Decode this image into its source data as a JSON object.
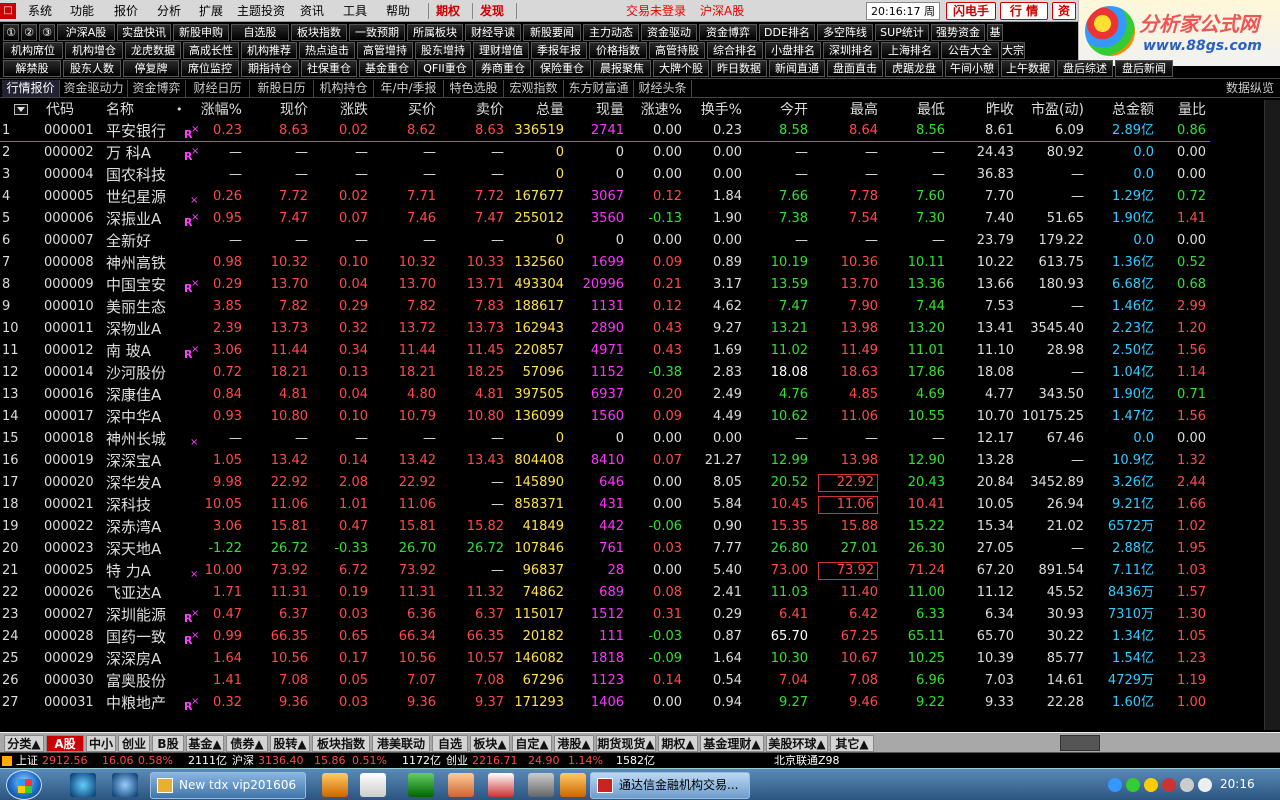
{
  "menubar": {
    "items": [
      "系统",
      "功能",
      "报价",
      "分析",
      "扩展",
      "主题投资",
      "资讯",
      "工具",
      "帮助"
    ],
    "quanquan": "期权",
    "faxian": "发现",
    "status": "交易未登录",
    "market": "沪深A股",
    "clock": "20:16:17 周二",
    "flash": "闪电手",
    "hangqing": "行 情",
    "zi": "资"
  },
  "brand": {
    "title": "分析家公式网",
    "url": "www.88gs.com"
  },
  "quick": {
    "row1": [
      {
        "t": "①",
        "c": ""
      },
      {
        "t": "②",
        "c": ""
      },
      {
        "t": "③",
        "c": ""
      },
      {
        "t": "沪深A股",
        "c": ""
      },
      {
        "t": "实盘快讯",
        "c": ""
      },
      {
        "t": "新股申购",
        "c": ""
      },
      {
        "t": "自选股",
        "c": ""
      },
      {
        "t": "板块指数",
        "c": ""
      },
      {
        "t": "一致预期",
        "c": ""
      },
      {
        "t": "所属板块",
        "c": ""
      },
      {
        "t": "财经导读",
        "c": ""
      },
      {
        "t": "新股要闻",
        "c": ""
      },
      {
        "t": "主力动态",
        "c": ""
      },
      {
        "t": "资金驱动",
        "c": ""
      },
      {
        "t": "资金博弈",
        "c": ""
      },
      {
        "t": "DDE排名",
        "c": ""
      },
      {
        "t": "多空阵线",
        "c": ""
      },
      {
        "t": "SUP统计",
        "c": ""
      },
      {
        "t": "强势资金",
        "c": ""
      },
      {
        "t": "基",
        "c": ""
      }
    ],
    "row2": [
      {
        "t": "机构席位",
        "c": ""
      },
      {
        "t": "机构增仓",
        "c": ""
      },
      {
        "t": "龙虎数据",
        "c": ""
      },
      {
        "t": "高成长性",
        "c": ""
      },
      {
        "t": "机构推荐",
        "c": ""
      },
      {
        "t": "热点追击",
        "c": ""
      },
      {
        "t": "高管增持",
        "c": ""
      },
      {
        "t": "股东增持",
        "c": ""
      },
      {
        "t": "理财增值",
        "c": ""
      },
      {
        "t": "季报年报",
        "c": ""
      },
      {
        "t": "价格指数",
        "c": ""
      },
      {
        "t": "高管持股",
        "c": ""
      },
      {
        "t": "综合排名",
        "c": ""
      },
      {
        "t": "小盘排名",
        "c": ""
      },
      {
        "t": "深圳排名",
        "c": ""
      },
      {
        "t": "上海排名",
        "c": ""
      },
      {
        "t": "公告大全",
        "c": ""
      },
      {
        "t": "大宗",
        "c": ""
      }
    ],
    "row3": [
      {
        "t": "解禁股",
        "c": ""
      },
      {
        "t": "股东人数",
        "c": ""
      },
      {
        "t": "停复牌",
        "c": ""
      },
      {
        "t": "席位监控",
        "c": ""
      },
      {
        "t": "期指持仓",
        "c": ""
      },
      {
        "t": "社保重仓",
        "c": ""
      },
      {
        "t": "基金重仓",
        "c": ""
      },
      {
        "t": "QFII重仓",
        "c": ""
      },
      {
        "t": "券商重仓",
        "c": ""
      },
      {
        "t": "保险重仓",
        "c": ""
      },
      {
        "t": "晨报聚焦",
        "c": ""
      },
      {
        "t": "大牌个股",
        "c": ""
      },
      {
        "t": "昨日数据",
        "c": ""
      },
      {
        "t": "新闻直通",
        "c": ""
      },
      {
        "t": "盘面直击",
        "c": ""
      },
      {
        "t": "虎踞龙盘",
        "c": ""
      },
      {
        "t": "午间小憩",
        "c": ""
      },
      {
        "t": "上午数据",
        "c": ""
      },
      {
        "t": "盘后综述",
        "c": ""
      },
      {
        "t": "盘后新闻",
        "c": ""
      }
    ]
  },
  "tabs": [
    "行情报价",
    "资金驱动力",
    "资金博弈",
    "财经日历",
    "新股日历",
    "机构持仓",
    "年/中/季报",
    "特色选股",
    "宏观指数",
    "东方财富通",
    "财经头条"
  ],
  "tabs_right": "数据纵览",
  "headers": [
    "代码",
    "名称",
    "•",
    "涨幅%",
    "现价",
    "涨跌",
    "买价",
    "卖价",
    "总量",
    "现量",
    "涨速%",
    "换手%",
    "今开",
    "最高",
    "最低",
    "昨收",
    "市盈(动)",
    "总金额",
    "量比"
  ],
  "rows": [
    [
      "1",
      "000001",
      "平安银行",
      "R",
      "0.23",
      "8.63",
      "0.02",
      "8.62",
      "8.63",
      "336519",
      "2741",
      "0.00",
      "0.23",
      "8.58",
      "8.64",
      "8.56",
      "8.61",
      "6.09",
      "2.89亿",
      "0.86"
    ],
    [
      "2",
      "000002",
      "万 科A",
      "R",
      "—",
      "—",
      "—",
      "—",
      "—",
      "0",
      "0",
      "0.00",
      "0.00",
      "—",
      "—",
      "—",
      "24.43",
      "80.92",
      "0.0",
      "0.00"
    ],
    [
      "3",
      "000004",
      "国农科技",
      "",
      "—",
      "—",
      "—",
      "—",
      "—",
      "0",
      "0",
      "0.00",
      "0.00",
      "—",
      "—",
      "—",
      "36.83",
      "—",
      "0.0",
      "0.00"
    ],
    [
      "4",
      "000005",
      "世纪星源",
      "x",
      "0.26",
      "7.72",
      "0.02",
      "7.71",
      "7.72",
      "167677",
      "3067",
      "0.12",
      "1.84",
      "7.66",
      "7.78",
      "7.60",
      "7.70",
      "—",
      "1.29亿",
      "0.72"
    ],
    [
      "5",
      "000006",
      "深振业A",
      "R",
      "0.95",
      "7.47",
      "0.07",
      "7.46",
      "7.47",
      "255012",
      "3560",
      "-0.13",
      "1.90",
      "7.38",
      "7.54",
      "7.30",
      "7.40",
      "51.65",
      "1.90亿",
      "1.41"
    ],
    [
      "6",
      "000007",
      "全新好",
      "",
      "—",
      "—",
      "—",
      "—",
      "—",
      "0",
      "0",
      "0.00",
      "0.00",
      "—",
      "—",
      "—",
      "23.79",
      "179.22",
      "0.0",
      "0.00"
    ],
    [
      "7",
      "000008",
      "神州高铁",
      "",
      "0.98",
      "10.32",
      "0.10",
      "10.32",
      "10.33",
      "132560",
      "1699",
      "0.09",
      "0.89",
      "10.19",
      "10.36",
      "10.11",
      "10.22",
      "613.75",
      "1.36亿",
      "0.52"
    ],
    [
      "8",
      "000009",
      "中国宝安",
      "R",
      "0.29",
      "13.70",
      "0.04",
      "13.70",
      "13.71",
      "493304",
      "20996",
      "0.21",
      "3.17",
      "13.59",
      "13.70",
      "13.36",
      "13.66",
      "180.93",
      "6.68亿",
      "0.68"
    ],
    [
      "9",
      "000010",
      "美丽生态",
      "",
      "3.85",
      "7.82",
      "0.29",
      "7.82",
      "7.83",
      "188617",
      "1131",
      "0.12",
      "4.62",
      "7.47",
      "7.90",
      "7.44",
      "7.53",
      "—",
      "1.46亿",
      "2.99"
    ],
    [
      "10",
      "000011",
      "深物业A",
      "",
      "2.39",
      "13.73",
      "0.32",
      "13.72",
      "13.73",
      "162943",
      "2890",
      "0.43",
      "9.27",
      "13.21",
      "13.98",
      "13.20",
      "13.41",
      "3545.40",
      "2.23亿",
      "1.20"
    ],
    [
      "11",
      "000012",
      "南 玻A",
      "R",
      "3.06",
      "11.44",
      "0.34",
      "11.44",
      "11.45",
      "220857",
      "4971",
      "0.43",
      "1.69",
      "11.02",
      "11.49",
      "11.01",
      "11.10",
      "28.98",
      "2.50亿",
      "1.56"
    ],
    [
      "12",
      "000014",
      "沙河股份",
      "",
      "0.72",
      "18.21",
      "0.13",
      "18.21",
      "18.25",
      "57096",
      "1152",
      "-0.38",
      "2.83",
      "18.08",
      "18.63",
      "17.86",
      "18.08",
      "—",
      "1.04亿",
      "1.14"
    ],
    [
      "13",
      "000016",
      "深康佳A",
      "",
      "0.84",
      "4.81",
      "0.04",
      "4.80",
      "4.81",
      "397505",
      "6937",
      "0.20",
      "2.49",
      "4.76",
      "4.85",
      "4.69",
      "4.77",
      "343.50",
      "1.90亿",
      "0.71"
    ],
    [
      "14",
      "000017",
      "深中华A",
      "",
      "0.93",
      "10.80",
      "0.10",
      "10.79",
      "10.80",
      "136099",
      "1560",
      "0.09",
      "4.49",
      "10.62",
      "11.06",
      "10.55",
      "10.70",
      "10175.25",
      "1.47亿",
      "1.56"
    ],
    [
      "15",
      "000018",
      "神州长城",
      "x",
      "—",
      "—",
      "—",
      "—",
      "—",
      "0",
      "0",
      "0.00",
      "0.00",
      "—",
      "—",
      "—",
      "12.17",
      "67.46",
      "0.0",
      "0.00"
    ],
    [
      "16",
      "000019",
      "深深宝A",
      "",
      "1.05",
      "13.42",
      "0.14",
      "13.42",
      "13.43",
      "804408",
      "8410",
      "0.07",
      "21.27",
      "12.99",
      "13.98",
      "12.90",
      "13.28",
      "—",
      "10.9亿",
      "1.32"
    ],
    [
      "17",
      "000020",
      "深华发A",
      "",
      "9.98",
      "22.92",
      "2.08",
      "22.92",
      "—",
      "145890",
      "646",
      "0.00",
      "8.05",
      "20.52",
      "22.92",
      "20.43",
      "20.84",
      "3452.89",
      "3.26亿",
      "2.44"
    ],
    [
      "18",
      "000021",
      "深科技",
      "",
      "10.05",
      "11.06",
      "1.01",
      "11.06",
      "—",
      "858371",
      "431",
      "0.00",
      "5.84",
      "10.45",
      "11.06",
      "10.41",
      "10.05",
      "26.94",
      "9.21亿",
      "1.66"
    ],
    [
      "19",
      "000022",
      "深赤湾A",
      "",
      "3.06",
      "15.81",
      "0.47",
      "15.81",
      "15.82",
      "41849",
      "442",
      "-0.06",
      "0.90",
      "15.35",
      "15.88",
      "15.22",
      "15.34",
      "21.02",
      "6572万",
      "1.02"
    ],
    [
      "20",
      "000023",
      "深天地A",
      "",
      "-1.22",
      "26.72",
      "-0.33",
      "26.70",
      "26.72",
      "107846",
      "761",
      "0.03",
      "7.77",
      "26.80",
      "27.01",
      "26.30",
      "27.05",
      "—",
      "2.88亿",
      "1.95"
    ],
    [
      "21",
      "000025",
      "特 力A",
      "x",
      "10.00",
      "73.92",
      "6.72",
      "73.92",
      "—",
      "96837",
      "28",
      "0.00",
      "5.40",
      "73.00",
      "73.92",
      "71.24",
      "67.20",
      "891.54",
      "7.11亿",
      "1.03"
    ],
    [
      "22",
      "000026",
      "飞亚达A",
      "",
      "1.71",
      "11.31",
      "0.19",
      "11.31",
      "11.32",
      "74862",
      "689",
      "0.08",
      "2.41",
      "11.03",
      "11.40",
      "11.00",
      "11.12",
      "45.52",
      "8436万",
      "1.57"
    ],
    [
      "23",
      "000027",
      "深圳能源",
      "R",
      "0.47",
      "6.37",
      "0.03",
      "6.36",
      "6.37",
      "115017",
      "1512",
      "0.31",
      "0.29",
      "6.41",
      "6.42",
      "6.33",
      "6.34",
      "30.93",
      "7310万",
      "1.30"
    ],
    [
      "24",
      "000028",
      "国药一致",
      "R",
      "0.99",
      "66.35",
      "0.65",
      "66.34",
      "66.35",
      "20182",
      "111",
      "-0.03",
      "0.87",
      "65.70",
      "67.25",
      "65.11",
      "65.70",
      "30.22",
      "1.34亿",
      "1.05"
    ],
    [
      "25",
      "000029",
      "深深房A",
      "",
      "1.64",
      "10.56",
      "0.17",
      "10.56",
      "10.57",
      "146082",
      "1818",
      "-0.09",
      "1.64",
      "10.30",
      "10.67",
      "10.25",
      "10.39",
      "85.77",
      "1.54亿",
      "1.23"
    ],
    [
      "26",
      "000030",
      "富奥股份",
      "",
      "1.41",
      "7.08",
      "0.05",
      "7.07",
      "7.08",
      "67296",
      "1123",
      "0.14",
      "0.54",
      "7.04",
      "7.08",
      "6.96",
      "7.03",
      "14.61",
      "4729万",
      "1.19"
    ],
    [
      "27",
      "000031",
      "中粮地产",
      "R",
      "0.32",
      "9.36",
      "0.03",
      "9.36",
      "9.37",
      "171293",
      "1406",
      "0.00",
      "0.94",
      "9.27",
      "9.46",
      "9.22",
      "9.33",
      "22.28",
      "1.60亿",
      "1.00"
    ]
  ],
  "bottom_tabs": [
    "分类▲",
    "A股",
    "中小",
    "创业",
    "B股",
    "基金▲",
    "债券▲",
    "股转▲",
    "板块指数",
    "港美联动",
    "自选",
    "板块▲",
    "自定▲",
    "港股▲",
    "期货现货▲",
    "期权▲",
    "基金理财▲",
    "美股环球▲",
    "其它▲"
  ],
  "ticker": {
    "sh_label": "上证",
    "sh_val": "2912.56",
    "sh_chg": "16.06",
    "sh_pct": "0.58%",
    "sh_amt": "2111亿",
    "hs_label": "沪深",
    "hs_val": "3136.40",
    "hs_chg": "15.86",
    "hs_pct": "0.51%",
    "hs_amt": "1172亿",
    "cy_label": "创业",
    "cy_val": "2216.71",
    "cy_chg": "24.90",
    "cy_pct": "1.14%",
    "cy_amt": "1582亿",
    "server": "北京联通Z98"
  },
  "taskbar": {
    "win1": "New tdx vip201606",
    "win2": "通达信金融机构交易...",
    "time": "20:16"
  },
  "colors": {
    "up": "#ff4a4a",
    "down": "#32e032",
    "flat": "#dddddd",
    "vol": "#ffe14a",
    "cur_vol": "#ff33ff",
    "amount": "#33ccff"
  }
}
